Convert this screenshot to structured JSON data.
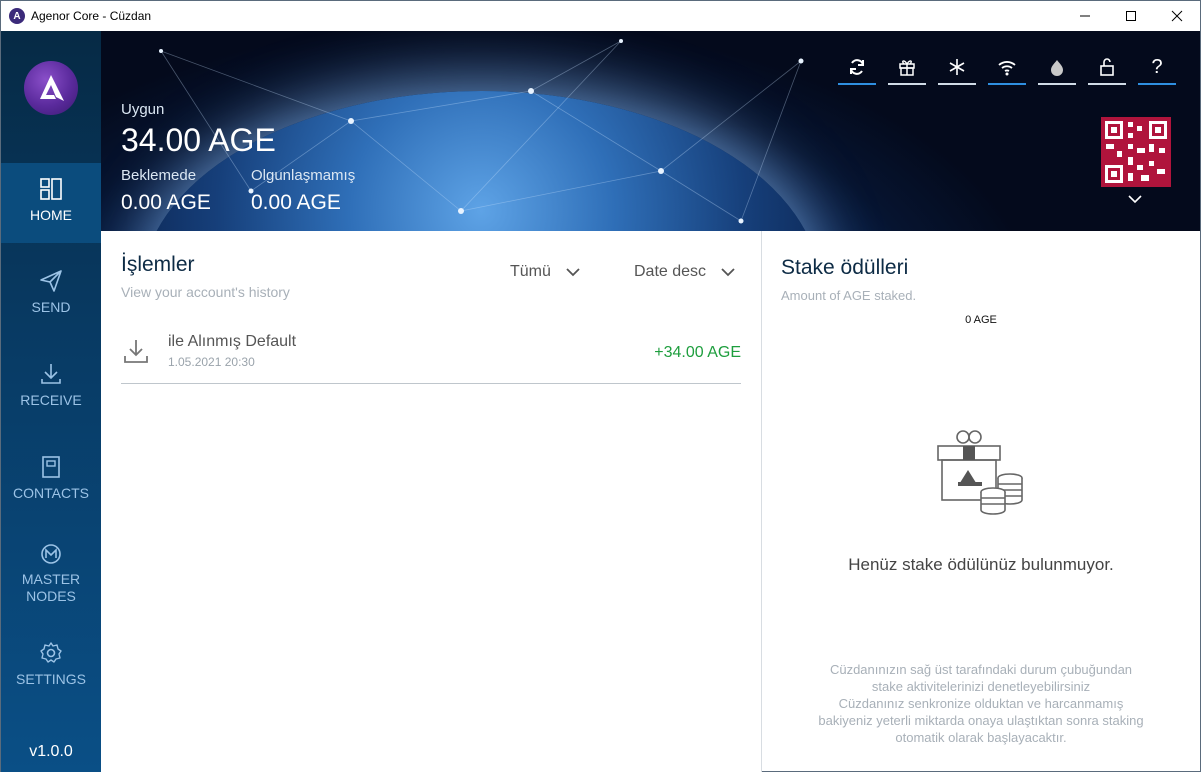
{
  "window": {
    "title": "Agenor Core - Cüzdan",
    "app_icon_letter": "A"
  },
  "sidebar": {
    "items": [
      {
        "label": "HOME",
        "icon": "home-grid-icon",
        "active": true
      },
      {
        "label": "SEND",
        "icon": "send-paper-plane-icon",
        "active": false
      },
      {
        "label": "RECEIVE",
        "icon": "receive-download-icon",
        "active": false
      },
      {
        "label": "CONTACTS",
        "icon": "contacts-book-icon",
        "active": false
      },
      {
        "label": "MASTER NODES",
        "icon": "masternodes-icon",
        "active": false
      },
      {
        "label": "SETTINGS",
        "icon": "settings-gear-icon",
        "active": false
      }
    ],
    "version": "v1.0.0"
  },
  "header": {
    "available_label": "Uygun",
    "available_value": "34.00 AGE",
    "pending_label": "Beklemede",
    "pending_value": "0.00 AGE",
    "immature_label": "Olgunlaşmamış",
    "immature_value": "0.00 AGE",
    "toolbar": [
      {
        "icon": "sync-icon",
        "active": true
      },
      {
        "icon": "gift-icon",
        "active": false
      },
      {
        "icon": "snowflake-icon",
        "active": false
      },
      {
        "icon": "wifi-icon",
        "active": true
      },
      {
        "icon": "tor-onion-icon",
        "active": false
      },
      {
        "icon": "unlock-icon",
        "active": false
      },
      {
        "icon": "help-icon",
        "label": "?",
        "active": true
      }
    ]
  },
  "transactions": {
    "title": "İşlemler",
    "subtitle": "View your account's history",
    "filter_type": "Tümü",
    "filter_sort": "Date desc",
    "rows": [
      {
        "title": "ile Alınmış Default",
        "date": "1.05.2021 20:30",
        "amount": "+34.00 AGE"
      }
    ]
  },
  "stake": {
    "title": "Stake ödülleri",
    "subtitle": "Amount of AGE staked.",
    "amount": "0 AGE",
    "empty_message": "Henüz stake ödülünüz bulunmuyor.",
    "info_lines": [
      "Cüzdanınızın sağ üst tarafındaki durum çubuğundan",
      "stake aktivitelerinizi denetleyebilirsiniz",
      "Cüzdanınız senkronize olduktan ve harcanmamış",
      "bakiyeniz yeterli miktarda onaya ulaştıktan sonra staking",
      "otomatik olarak başlayacaktır."
    ]
  },
  "colors": {
    "accent": "#2f8fe0",
    "positive": "#1e9e3e",
    "qr": "#b0143c"
  }
}
